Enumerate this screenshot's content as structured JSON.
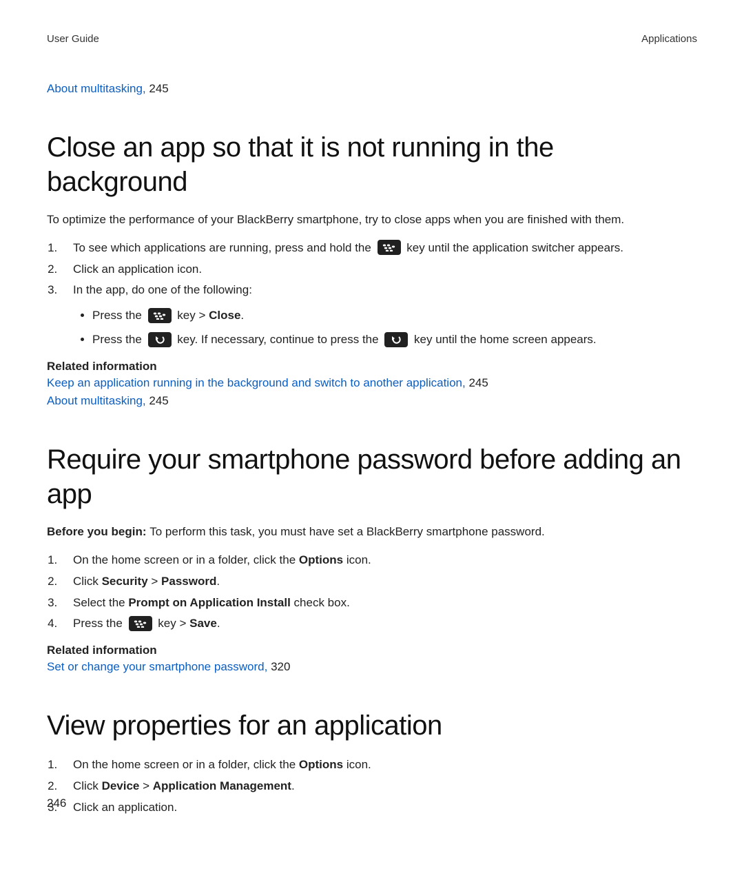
{
  "header": {
    "left": "User Guide",
    "right": "Applications"
  },
  "topLink": {
    "text": "About multitasking,",
    "page": "245"
  },
  "sec1": {
    "title": "Close an app so that it is not running in the background",
    "intro": "To optimize the performance of your BlackBerry smartphone, try to close apps when you are finished with them.",
    "step1_pre": "To see which applications are running, press and hold the ",
    "step1_post": " key until the application switcher appears.",
    "step2": "Click an application icon.",
    "step3": "In the app, do one of the following:",
    "s3a_pre": "Press the ",
    "s3a_mid": " key > ",
    "s3a_bold": "Close",
    "s3a_end": ".",
    "s3b_pre": "Press the ",
    "s3b_mid": " key. If necessary, continue to press the ",
    "s3b_post": " key until the home screen appears.",
    "relHead": "Related information",
    "relA": {
      "text": "Keep an application running in the background and switch to another application,",
      "page": "245"
    },
    "relB": {
      "text": "About multitasking,",
      "page": "245"
    }
  },
  "sec2": {
    "title": "Require your smartphone password before adding an app",
    "begin_label": "Before you begin: ",
    "begin_text": "To perform this task, you must have set a BlackBerry smartphone password.",
    "step1_pre": "On the home screen or in a folder, click the ",
    "step1_bold": "Options",
    "step1_post": " icon.",
    "step2_pre": "Click ",
    "step2_b1": "Security",
    "step2_mid": " > ",
    "step2_b2": "Password",
    "step2_end": ".",
    "step3_pre": "Select the ",
    "step3_bold": "Prompt on Application Install",
    "step3_post": " check box.",
    "step4_pre": "Press the ",
    "step4_mid": " key > ",
    "step4_bold": "Save",
    "step4_end": ".",
    "relHead": "Related information",
    "relA": {
      "text": "Set or change your smartphone password,",
      "page": "320"
    }
  },
  "sec3": {
    "title": "View properties for an application",
    "step1_pre": "On the home screen or in a folder, click the ",
    "step1_bold": "Options",
    "step1_post": " icon.",
    "step2_pre": "Click ",
    "step2_b1": "Device",
    "step2_mid": " > ",
    "step2_b2": "Application Management",
    "step2_end": ".",
    "step3": "Click an application."
  },
  "pageNumber": "246"
}
